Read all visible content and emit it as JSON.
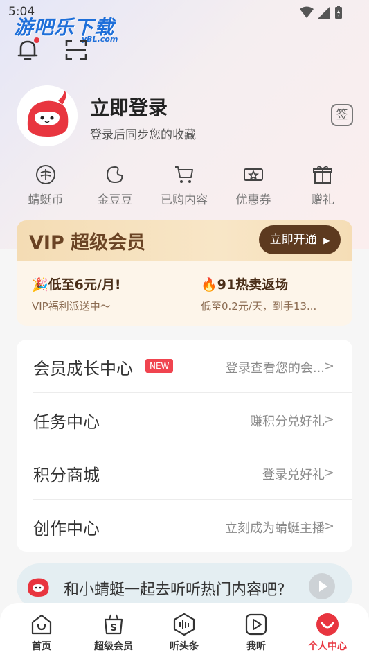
{
  "status_bar": {
    "time": "5:04"
  },
  "watermark": {
    "name": "游吧乐下载",
    "sub": "yBL.com"
  },
  "profile": {
    "title": "立即登录",
    "subtitle": "登录后同步您的收藏",
    "sign_label": "签"
  },
  "quick_actions": [
    {
      "label": "蜻蜓币",
      "icon": "dragonfly-coin-icon"
    },
    {
      "label": "金豆豆",
      "icon": "gold-bean-icon"
    },
    {
      "label": "已购内容",
      "icon": "cart-icon"
    },
    {
      "label": "优惠券",
      "icon": "coupon-icon"
    },
    {
      "label": "赠礼",
      "icon": "gift-icon"
    }
  ],
  "vip": {
    "title": "VIP 超级会员",
    "button": "立即开通",
    "left": {
      "emoji": "🎉",
      "title": "低至6元/月!",
      "subtitle": "VIP福利派送中～"
    },
    "right": {
      "emoji": "🔥",
      "title": "91热卖返场",
      "subtitle": "低至0.2元/天，到手13..."
    }
  },
  "menu": [
    {
      "label": "会员成长中心",
      "badge": "NEW",
      "right": "登录查看您的会..."
    },
    {
      "label": "任务中心",
      "right": "赚积分兑好礼"
    },
    {
      "label": "积分商城",
      "right": "登录兑好礼"
    },
    {
      "label": "创作中心",
      "right": "立刻成为蜻蜓主播"
    }
  ],
  "player": {
    "text": "和小蜻蜓一起去听听热门内容吧?"
  },
  "tabs": [
    {
      "label": "首页",
      "icon": "home-icon"
    },
    {
      "label": "超级会员",
      "icon": "vip-bag-icon"
    },
    {
      "label": "听头条",
      "icon": "headline-icon"
    },
    {
      "label": "我听",
      "icon": "play-square-icon"
    },
    {
      "label": "个人中心",
      "icon": "profile-icon",
      "active": true
    }
  ],
  "colors": {
    "accent": "#e8353f",
    "vip_dark": "#5d3a1f",
    "badge": "#f0444f"
  }
}
